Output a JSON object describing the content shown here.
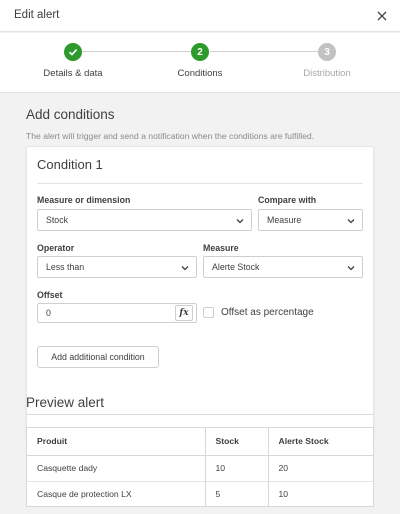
{
  "dialog": {
    "title": "Edit alert",
    "close_icon": "close-icon"
  },
  "stepper": {
    "steps": [
      {
        "number": "1",
        "label": "Details & data",
        "state": "completed"
      },
      {
        "number": "2",
        "label": "Conditions",
        "state": "active"
      },
      {
        "number": "3",
        "label": "Distribution",
        "state": "pending"
      }
    ],
    "colors": {
      "completed": "#2e9a2e",
      "active": "#2e9a2e",
      "pending": "#c2c2c2",
      "pending_label": "#a8a8a8"
    }
  },
  "conditions": {
    "title": "Add conditions",
    "description": "The alert will trigger and send a notification when the conditions are fulfilled.",
    "card": {
      "title": "Condition 1",
      "measure_or_dimension": {
        "label": "Measure or dimension",
        "value": "Stock"
      },
      "compare_with": {
        "label": "Compare with",
        "value": "Measure"
      },
      "operator": {
        "label": "Operator",
        "value": "Less than"
      },
      "measure": {
        "label": "Measure",
        "value": "Alerte Stock"
      },
      "offset": {
        "label": "Offset",
        "value": "0",
        "fx_label": "fx"
      },
      "offset_as_percentage": {
        "label": "Offset as percentage",
        "checked": false
      },
      "add_button": "Add additional condition"
    }
  },
  "preview": {
    "title": "Preview alert",
    "columns": [
      "Produit",
      "Stock",
      "Alerte Stock"
    ],
    "rows": [
      [
        "Casquette dady",
        "10",
        "20"
      ],
      [
        "Casque de protection LX",
        "5",
        "10"
      ]
    ]
  }
}
